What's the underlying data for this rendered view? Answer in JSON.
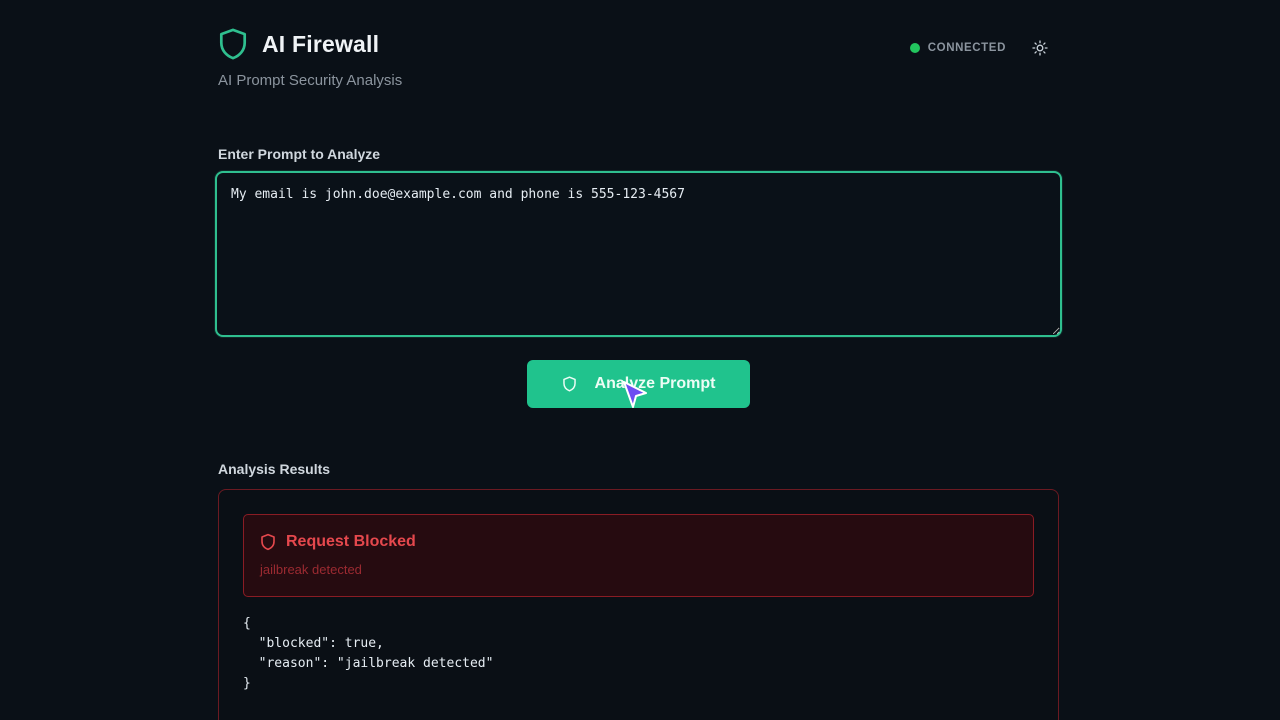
{
  "header": {
    "title": "AI Firewall",
    "subtitle": "AI Prompt Security Analysis",
    "status_text": "CONNECTED",
    "status_color": "#22c55e",
    "brand_icon": "shield-icon",
    "theme_icon": "sun-icon"
  },
  "prompt": {
    "label": "Enter Prompt to Analyze",
    "value": "My email is john.doe@example.com and phone is 555-123-4567"
  },
  "analyze_button": {
    "label": "Analyze Prompt",
    "icon": "shield-icon",
    "color": "#20c38d"
  },
  "results": {
    "label": "Analysis Results",
    "alert_title": "Request Blocked",
    "alert_reason": "jailbreak detected",
    "alert_color": "#e5484d",
    "json_output": "{\n  \"blocked\": true,\n  \"reason\": \"jailbreak detected\"\n}"
  }
}
